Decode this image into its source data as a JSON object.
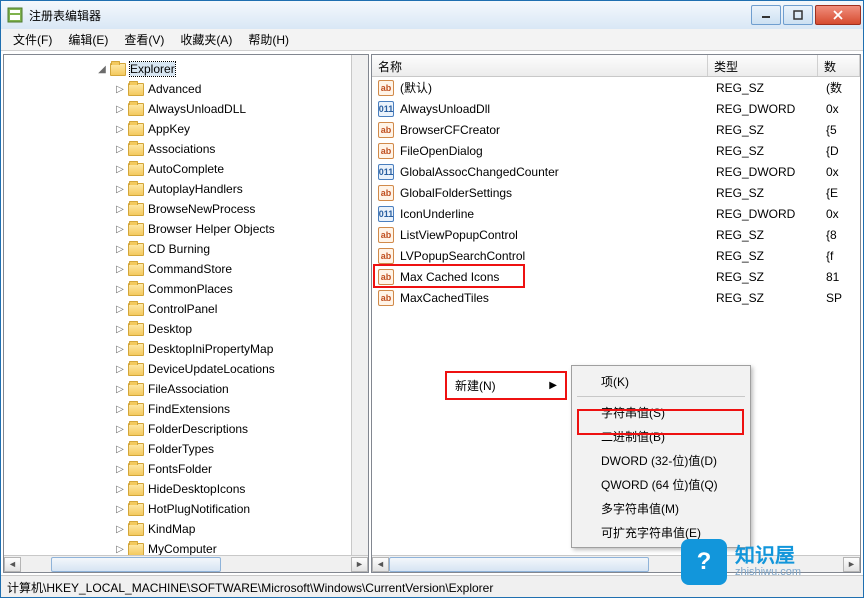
{
  "window": {
    "title": "注册表编辑器"
  },
  "menu": {
    "file": "文件(F)",
    "edit": "编辑(E)",
    "view": "查看(V)",
    "favorites": "收藏夹(A)",
    "help": "帮助(H)"
  },
  "tree": {
    "root": "Explorer",
    "children": [
      "Advanced",
      "AlwaysUnloadDLL",
      "AppKey",
      "Associations",
      "AutoComplete",
      "AutoplayHandlers",
      "BrowseNewProcess",
      "Browser Helper Objects",
      "CD Burning",
      "CommandStore",
      "CommonPlaces",
      "ControlPanel",
      "Desktop",
      "DesktopIniPropertyMap",
      "DeviceUpdateLocations",
      "FileAssociation",
      "FindExtensions",
      "FolderDescriptions",
      "FolderTypes",
      "FontsFolder",
      "HideDesktopIcons",
      "HotPlugNotification",
      "KindMap",
      "MyComputer"
    ]
  },
  "list": {
    "cols": {
      "name": "名称",
      "type": "类型",
      "data": "数"
    },
    "rows": [
      {
        "icon": "sz",
        "name": "(默认)",
        "type": "REG_SZ",
        "data": "(数"
      },
      {
        "icon": "dw",
        "name": "AlwaysUnloadDll",
        "type": "REG_DWORD",
        "data": "0x"
      },
      {
        "icon": "sz",
        "name": "BrowserCFCreator",
        "type": "REG_SZ",
        "data": "{5"
      },
      {
        "icon": "sz",
        "name": "FileOpenDialog",
        "type": "REG_SZ",
        "data": "{D"
      },
      {
        "icon": "dw",
        "name": "GlobalAssocChangedCounter",
        "type": "REG_DWORD",
        "data": "0x"
      },
      {
        "icon": "sz",
        "name": "GlobalFolderSettings",
        "type": "REG_SZ",
        "data": "{E"
      },
      {
        "icon": "dw",
        "name": "IconUnderline",
        "type": "REG_DWORD",
        "data": "0x"
      },
      {
        "icon": "sz",
        "name": "ListViewPopupControl",
        "type": "REG_SZ",
        "data": "{8"
      },
      {
        "icon": "sz",
        "name": "LVPopupSearchControl",
        "type": "REG_SZ",
        "data": "{f"
      },
      {
        "icon": "sz",
        "name": "Max Cached Icons",
        "type": "REG_SZ",
        "data": "81"
      },
      {
        "icon": "sz",
        "name": "MaxCachedTiles",
        "type": "REG_SZ",
        "data": "SP"
      }
    ]
  },
  "context": {
    "new_label": "新建(N)",
    "items": {
      "key": "项(K)",
      "string": "字符串值(S)",
      "binary": "二进制值(B)",
      "dword32": "DWORD (32-位)值(D)",
      "qword64": "QWORD (64 位)值(Q)",
      "multisz": "多字符串值(M)",
      "expandsz": "可扩充字符串值(E)"
    }
  },
  "statusbar": "计算机\\HKEY_LOCAL_MACHINE\\SOFTWARE\\Microsoft\\Windows\\CurrentVersion\\Explorer",
  "watermark": {
    "brand": "知识屋",
    "url": "zhishiwu.com",
    "badge": "?"
  }
}
